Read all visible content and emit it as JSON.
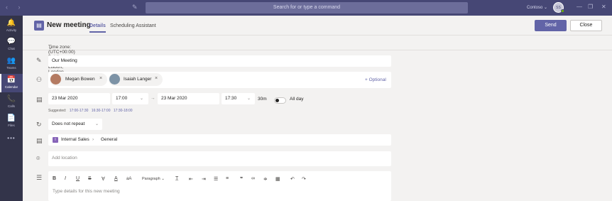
{
  "topbar": {
    "search_placeholder": "Search for or type a command",
    "tenant": "Contoso",
    "avatar_initials": "SS"
  },
  "rail": [
    {
      "icon": "bell-icon",
      "glyph": "🔔",
      "label": "Activity"
    },
    {
      "icon": "chat-icon",
      "glyph": "💬",
      "label": "Chat"
    },
    {
      "icon": "teams-icon",
      "glyph": "👥",
      "label": "Teams"
    },
    {
      "icon": "calendar-icon",
      "glyph": "📅",
      "label": "Calendar",
      "active": true
    },
    {
      "icon": "phone-icon",
      "glyph": "📞",
      "label": "Calls"
    },
    {
      "icon": "file-icon",
      "glyph": "📄",
      "label": "Files"
    },
    {
      "icon": "more-icon",
      "glyph": "•••",
      "label": ""
    }
  ],
  "header": {
    "title": "New meeting",
    "tabs": [
      "Details",
      "Scheduling Assistant"
    ],
    "send": "Send",
    "close": "Close"
  },
  "timezone": "Time zone: (UTC+00:00) Dublin, Edinburgh, Lisbon, London",
  "form": {
    "title_value": "Our Meeting",
    "attendees": [
      "Megan Bowen",
      "Isaiah Langer"
    ],
    "optional": "+ Optional",
    "start_date": "23 Mar 2020",
    "start_time": "17:00",
    "end_date": "23 Mar 2020",
    "end_time": "17:30",
    "duration": "30m",
    "allday": "All day",
    "suggested_label": "Suggested:",
    "suggested": [
      "17:00-17:30",
      "16:30-17:00",
      "17:30-18:00"
    ],
    "repeat": "Does not repeat",
    "channel_team": "Internal Sales",
    "channel_name": "General",
    "location_placeholder": "Add location",
    "paragraph": "Paragraph",
    "details_placeholder": "Type details for this new meeting"
  }
}
